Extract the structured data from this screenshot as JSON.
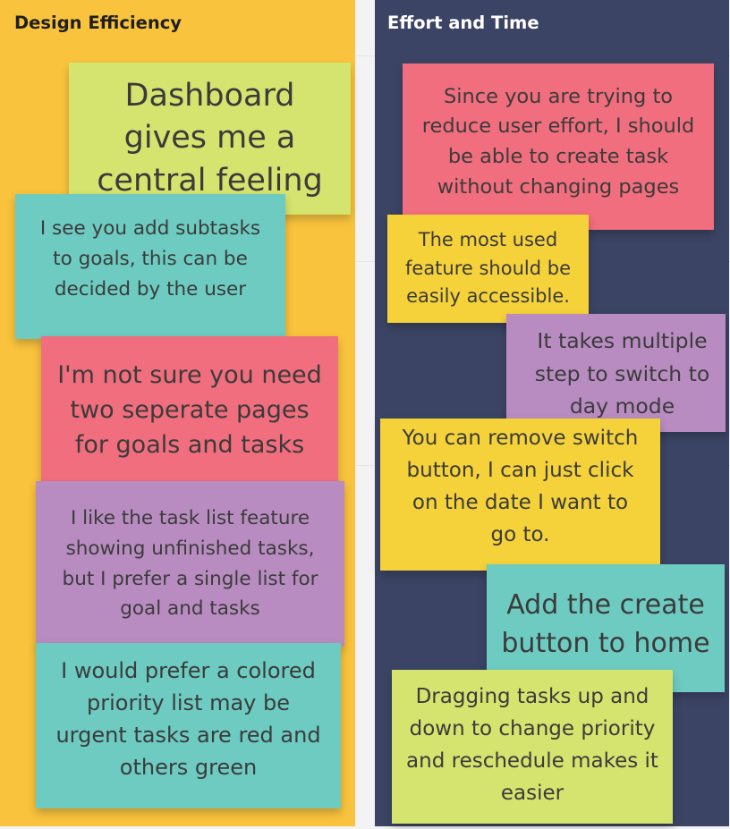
{
  "board": {
    "columns": [
      {
        "title": "Design Efficiency",
        "color": "#f9c33d",
        "notes": [
          {
            "text": "Dashboard gives me a central feeling",
            "color": "#d5e46f"
          },
          {
            "text": "I see you add subtasks to goals, this can be decided by the user",
            "color": "#6dcbc1"
          },
          {
            "text": "I'm not sure you need two seperate pages for goals and tasks",
            "color": "#f06e7d"
          },
          {
            "text": "I like the task list feature showing unfinished tasks, but I prefer a single list for goal and tasks",
            "color": "#b88cc0"
          },
          {
            "text": "I would prefer a colored priority list may be urgent tasks are red and others green",
            "color": "#6dcbc1"
          }
        ]
      },
      {
        "title": "Effort and Time",
        "color": "#3b4464",
        "notes": [
          {
            "text": "Since you are trying to reduce user effort, I should be able to create task without changing pages",
            "color": "#f06e7d"
          },
          {
            "text": "The most used feature should be easily accessible.",
            "color": "#f5d23a"
          },
          {
            "text": "It takes multiple step to switch to day mode",
            "color": "#b88cc0"
          },
          {
            "text": "You can remove switch button, I can just click on the date I want to go to.",
            "color": "#f5d23a"
          },
          {
            "text": "Add the create button to home",
            "color": "#6dcbc1"
          },
          {
            "text": "Dragging tasks up and down to change priority and reschedule makes it easier",
            "color": "#d5e46f"
          }
        ]
      }
    ]
  }
}
